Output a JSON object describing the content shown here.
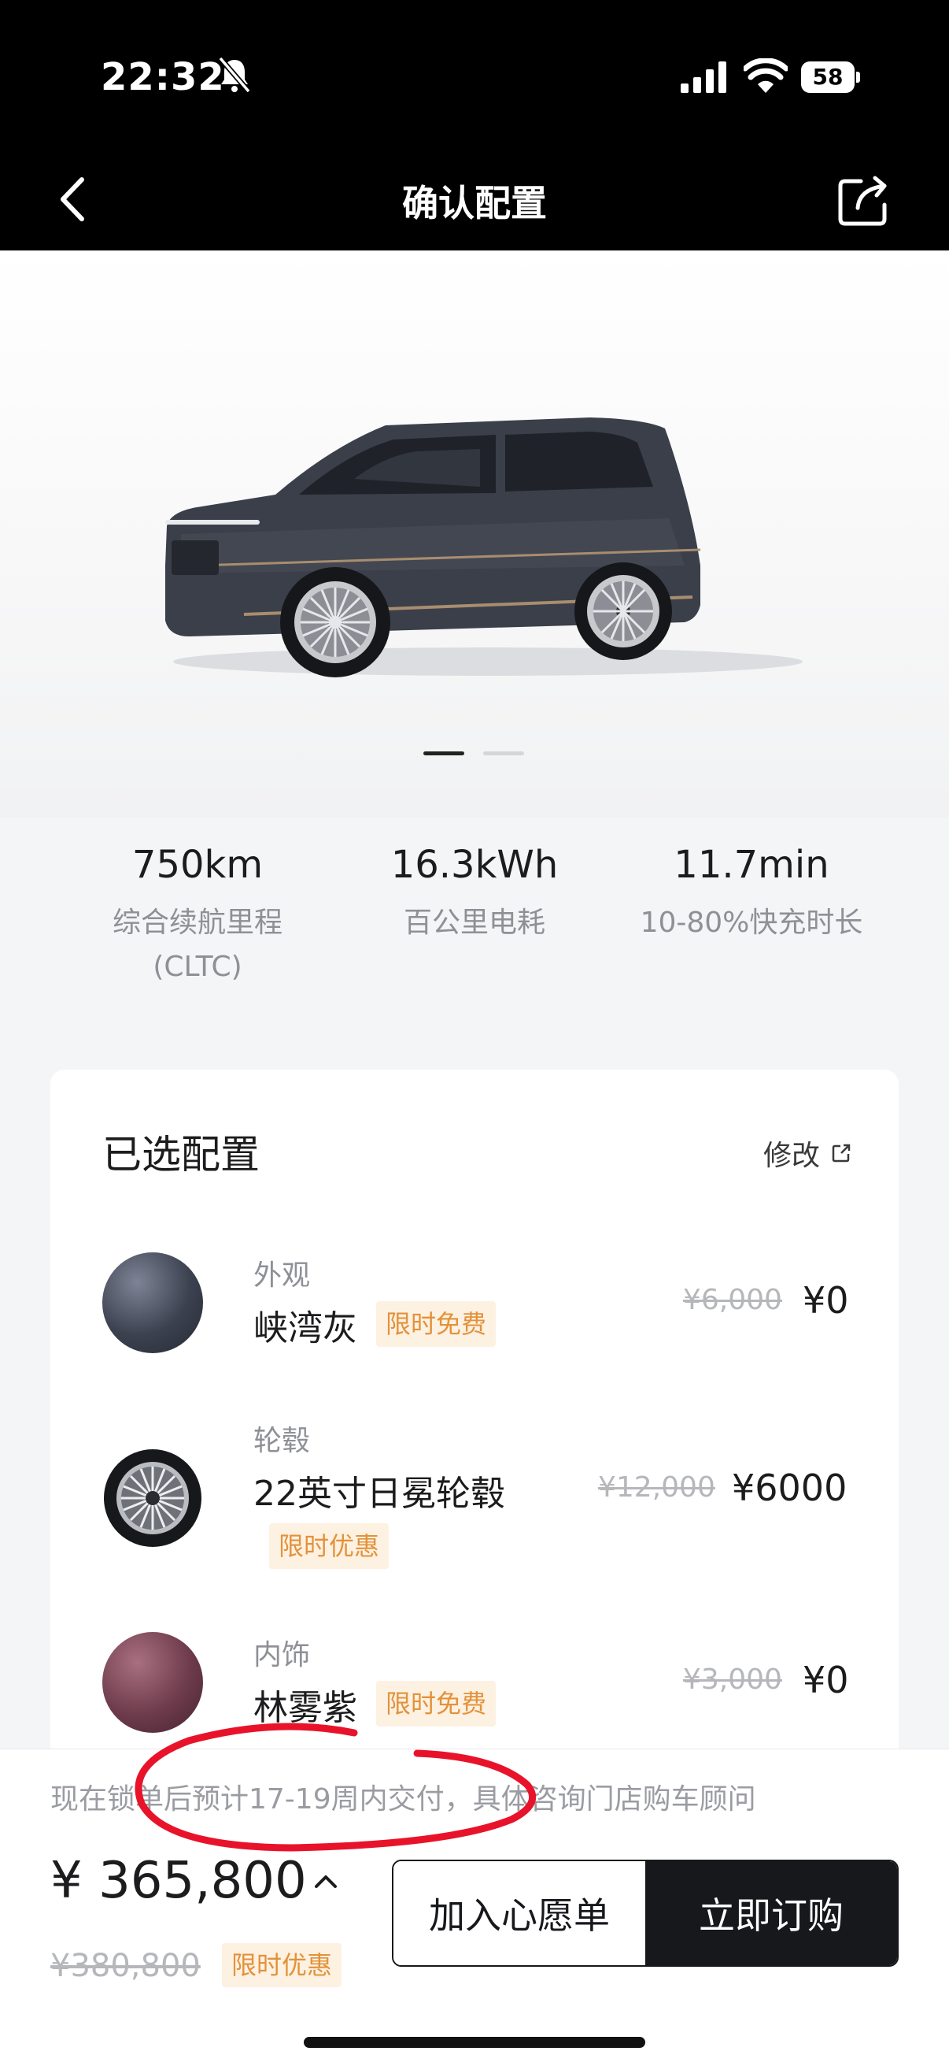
{
  "status_bar": {
    "time": "22:32",
    "battery": "58",
    "icons": [
      "bell-slash-icon",
      "signal-icon",
      "wifi-icon",
      "battery-icon"
    ]
  },
  "nav": {
    "title": "确认配置",
    "back_icon": "chevron-left-icon",
    "share_icon": "share-icon"
  },
  "carousel": {
    "pages": 2,
    "active": 1
  },
  "specs": [
    {
      "value": "750km",
      "label": "综合续航里程\n(CLTC)"
    },
    {
      "value": "16.3kWh",
      "label": "百公里电耗"
    },
    {
      "value": "11.7min",
      "label": "10-80%快充时长"
    }
  ],
  "config": {
    "title": "已选配置",
    "edit_label": "修改",
    "items": [
      {
        "category": "外观",
        "name": "峡湾灰",
        "tag": "限时免费",
        "original_price": "¥6,000",
        "price": "¥0",
        "swatch_color": "#3c4150"
      },
      {
        "category": "轮毂",
        "name": "22英寸日冕轮毂",
        "tag": "限时优惠",
        "original_price": "¥12,000",
        "price": "¥6000"
      },
      {
        "category": "内饰",
        "name": "林雾紫",
        "tag": "限时免费",
        "original_price": "¥3,000",
        "price": "¥0",
        "swatch_color": "#6d3b4c"
      }
    ]
  },
  "footer": {
    "delivery_note": "现在锁单后预计17-19周内交付，具体咨询门店购车顾问",
    "total_price": "¥ 365,800",
    "original_total": "¥380,800",
    "total_tag": "限时优惠",
    "wishlist_label": "加入心愿单",
    "buy_label": "立即订购"
  },
  "colors": {
    "accent_tag_bg": "#fdf1e2",
    "accent_tag_text": "#e3923a",
    "primary_button": "#16181c",
    "annotation": "#e8132a"
  }
}
